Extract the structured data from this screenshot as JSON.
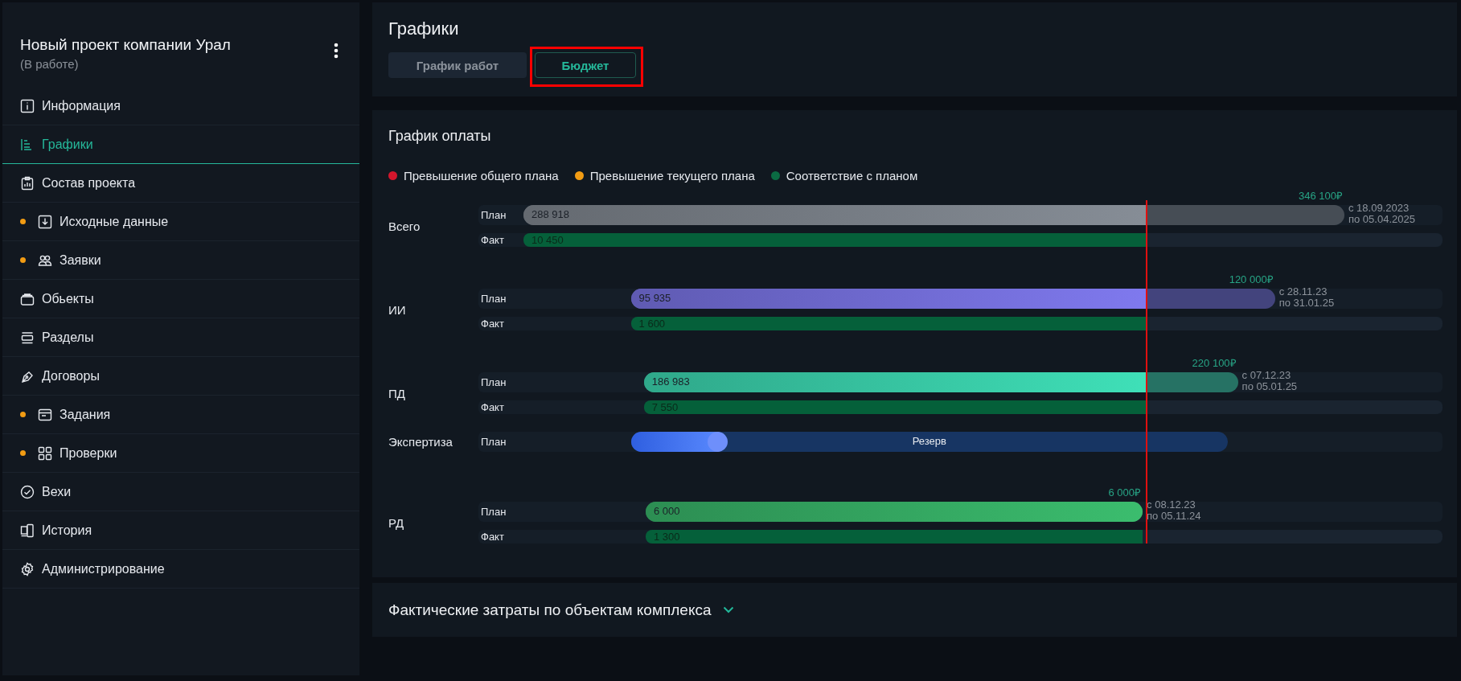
{
  "sidebar": {
    "title": "Новый проект компании Урал",
    "status": "(В работе)",
    "items": [
      {
        "label": "Информация",
        "marked": false,
        "selected": false
      },
      {
        "label": "Графики",
        "marked": false,
        "selected": true
      },
      {
        "label": "Состав проекта",
        "marked": false,
        "selected": false
      },
      {
        "label": "Исходные данные",
        "marked": true,
        "selected": false
      },
      {
        "label": "Заявки",
        "marked": true,
        "selected": false
      },
      {
        "label": "Обьекты",
        "marked": false,
        "selected": false
      },
      {
        "label": "Разделы",
        "marked": false,
        "selected": false
      },
      {
        "label": "Договоры",
        "marked": false,
        "selected": false
      },
      {
        "label": "Задания",
        "marked": true,
        "selected": false
      },
      {
        "label": "Проверки",
        "marked": true,
        "selected": false
      },
      {
        "label": "Вехи",
        "marked": false,
        "selected": false
      },
      {
        "label": "История",
        "marked": false,
        "selected": false
      },
      {
        "label": "Администрирование",
        "marked": false,
        "selected": false
      }
    ]
  },
  "header": {
    "title": "Графики",
    "tabs": [
      {
        "label": "График работ",
        "selected": false
      },
      {
        "label": "Бюджет",
        "selected": true
      }
    ]
  },
  "payments": {
    "title": "График оплаты",
    "legend": [
      {
        "label": "Превышение общего плана",
        "color": "#d3162c"
      },
      {
        "label": "Превышение текущего плана",
        "color": "#f29c13"
      },
      {
        "label": "Соответствие с планом",
        "color": "#0b6b43"
      }
    ],
    "rows": [
      {
        "name": "Всего",
        "kind": "budget",
        "total": "346 100₽",
        "from": "с 18.09.2023",
        "to": "по 05.04.2025",
        "plan": {
          "label": "План",
          "value": "288 918",
          "level": 0.76,
          "color": "#868d96"
        },
        "fact": {
          "label": "Факт",
          "value": "10 450",
          "level": 0.678
        }
      },
      {
        "name": "ИИ",
        "kind": "budget",
        "total": "120 000₽",
        "from": "с 28.11.23",
        "to": "по 31.01.25",
        "plan": {
          "label": "План",
          "value": "95 935",
          "level": 0.8,
          "color": "#7f79ee"
        },
        "fact": {
          "label": "Факт",
          "value": "1 600",
          "level": 0.635
        }
      },
      {
        "name": "ПД",
        "kind": "budget",
        "total": "220 100₽",
        "from": "с 07.12.23",
        "to": "по 05.01.25",
        "plan": {
          "label": "План",
          "value": "186 983",
          "level": 0.845,
          "color": "#3fe0b8"
        },
        "fact": {
          "label": "Факт",
          "value": "7 550",
          "level": 0.629
        }
      },
      {
        "name": "Экспертиза",
        "kind": "reserve",
        "plan": {
          "label": "План",
          "value": "Резерв",
          "level": 0.16,
          "color": "#5b8bff"
        }
      },
      {
        "name": "РД",
        "kind": "budget",
        "total": "6 000₽",
        "from": "с 08.12.23",
        "to": "по 05.11.24",
        "plan": {
          "label": "План",
          "value": "6 000",
          "level": 1,
          "color": "#3bbd6e"
        },
        "fact": {
          "label": "Факт",
          "value": "1 300",
          "level": 0.624
        }
      }
    ]
  },
  "costs": {
    "title": "Фактические затраты по объектам комплекса",
    "expanded": false
  }
}
